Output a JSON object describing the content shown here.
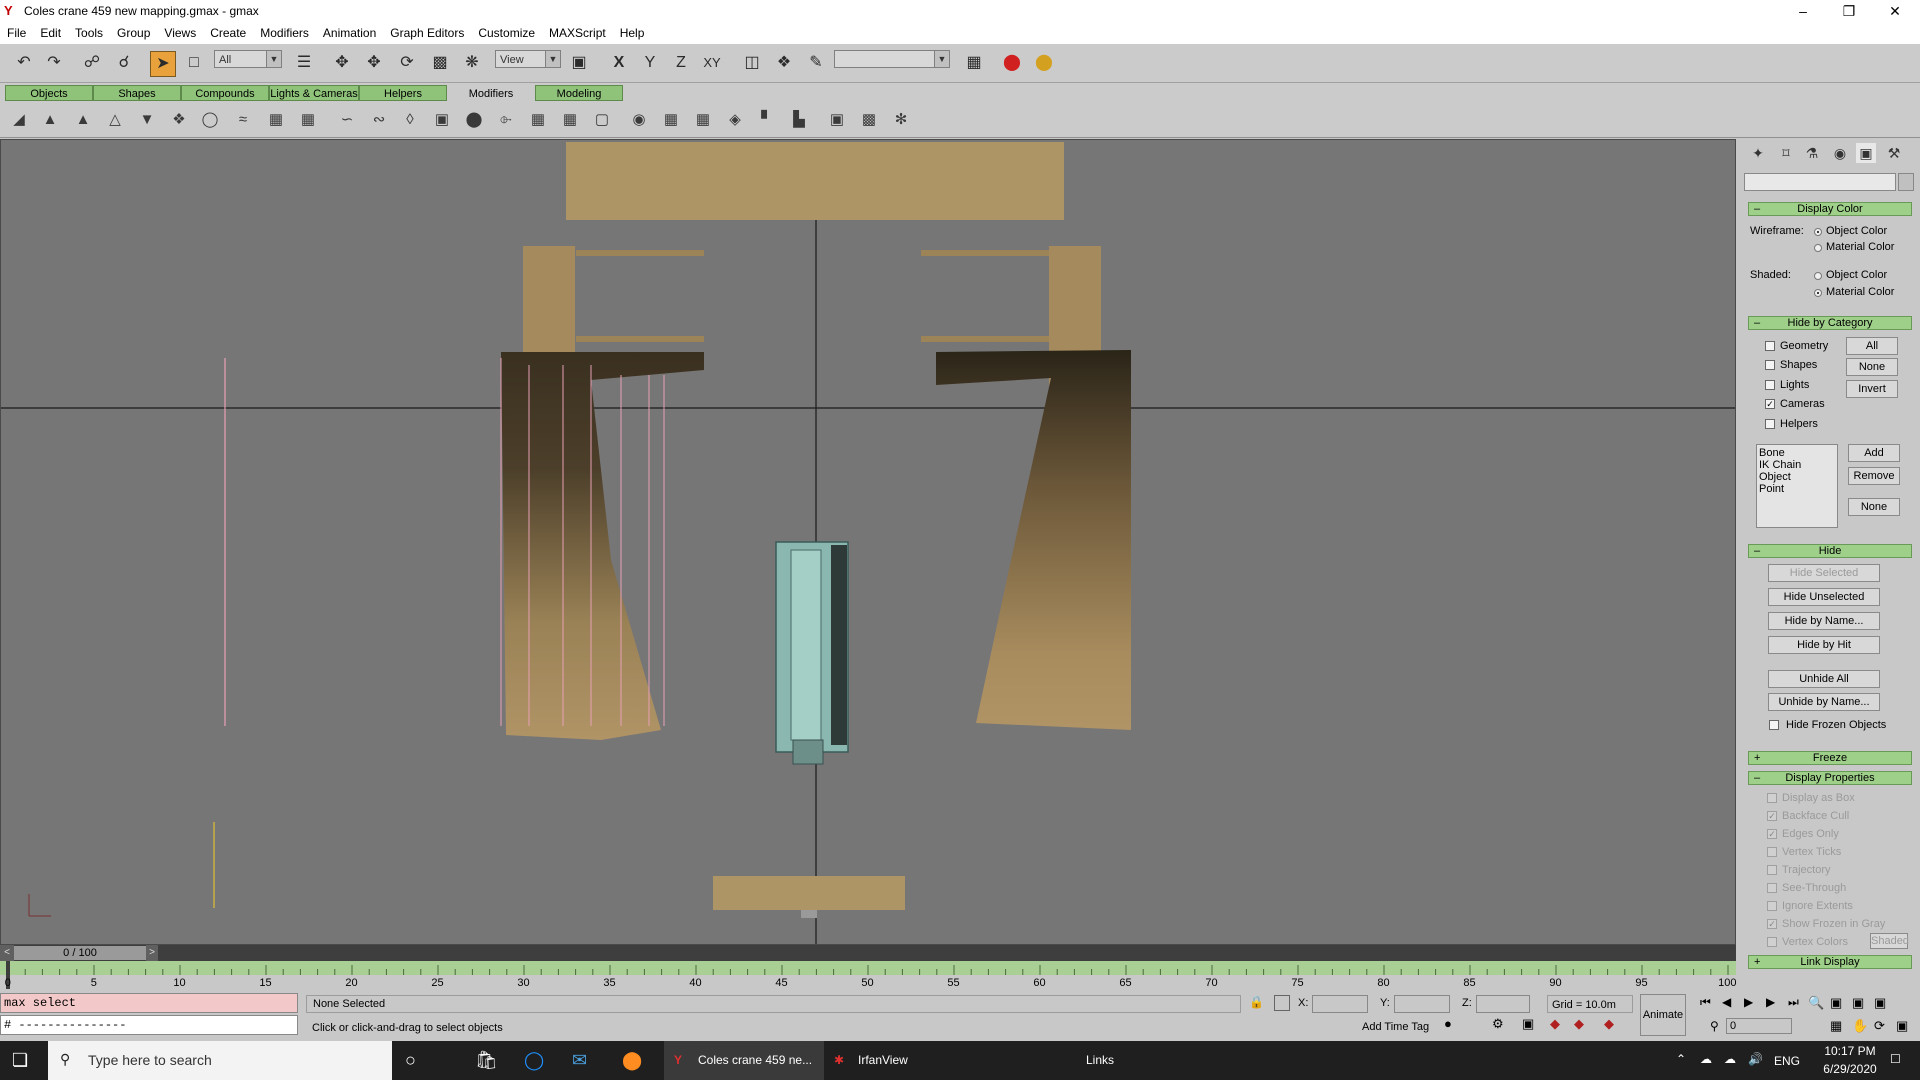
{
  "window": {
    "title": "Coles crane 459 new mapping.gmax - gmax",
    "app_icon": "gmax-logo-icon",
    "controls": [
      "minimize",
      "restore",
      "close"
    ]
  },
  "menubar": [
    "File",
    "Edit",
    "Tools",
    "Group",
    "Views",
    "Create",
    "Modifiers",
    "Animation",
    "Graph Editors",
    "Customize",
    "MAXScript",
    "Help"
  ],
  "toolbar": {
    "selection_filter": "All",
    "ref_coord": "View",
    "axis_x": "X",
    "axis_y": "Y",
    "axis_z": "Z",
    "axis_xy": "XY",
    "named_selection": ""
  },
  "tabs": [
    "Objects",
    "Shapes",
    "Compounds",
    "Lights & Cameras",
    "Helpers",
    "Modifiers",
    "Modeling"
  ],
  "selected_tab": "Modifiers",
  "command_panel": {
    "name_field": "",
    "display_color": {
      "title": "Display Color",
      "wireframe_label": "Wireframe:",
      "shaded_label": "Shaded:",
      "object_color": "Object Color",
      "material_color": "Material Color"
    },
    "hide_by_category": {
      "title": "Hide by Category",
      "items": [
        "Geometry",
        "Shapes",
        "Lights",
        "Cameras",
        "Helpers"
      ],
      "checked": [
        "Cameras"
      ],
      "btn_all": "All",
      "btn_none": "None",
      "btn_invert": "Invert",
      "list": [
        "Bone",
        "IK Chain Object",
        "Point"
      ],
      "btn_add": "Add",
      "btn_remove": "Remove",
      "btn_none2": "None"
    },
    "hide": {
      "title": "Hide",
      "hide_selected": "Hide Selected",
      "hide_unselected": "Hide Unselected",
      "hide_by_name": "Hide by Name...",
      "hide_by_hit": "Hide by Hit",
      "unhide_all": "Unhide All",
      "unhide_by_name": "Unhide by Name...",
      "hide_frozen": "Hide Frozen Objects"
    },
    "freeze": {
      "title": "Freeze"
    },
    "display_properties": {
      "title": "Display Properties",
      "items": [
        "Display as Box",
        "Backface Cull",
        "Edges Only",
        "Vertex Ticks",
        "Trajectory",
        "See-Through",
        "Ignore Extents",
        "Show Frozen in Gray",
        "Vertex Colors"
      ],
      "checked": [
        "Backface Cull",
        "Edges Only",
        "Show Frozen in Gray"
      ],
      "shaded_btn": "Shaded"
    },
    "link_display": {
      "title": "Link Display"
    }
  },
  "timeline": {
    "frame_display": "0 / 100",
    "ticks": [
      "0",
      "5",
      "10",
      "15",
      "20",
      "25",
      "30",
      "35",
      "40",
      "45",
      "50",
      "55",
      "60",
      "65",
      "70",
      "75",
      "80",
      "85",
      "90",
      "95",
      "100"
    ]
  },
  "status": {
    "maxscript_input": "max select",
    "maxscript_output": "# ---------------",
    "selection": "None Selected",
    "prompt": "Click or click-and-drag to select objects",
    "x_label": "X:",
    "y_label": "Y:",
    "z_label": "Z:",
    "grid": "Grid = 10.0m",
    "add_time_tag": "Add Time Tag",
    "animate": "Animate",
    "frame_field": "0"
  },
  "taskbar": {
    "search_placeholder": "Type here to search",
    "apps": [
      "Coles crane 459 ne...",
      "IrfanView"
    ],
    "links": "Links",
    "language": "ENG",
    "time": "10:17 PM",
    "date": "6/29/2020"
  }
}
